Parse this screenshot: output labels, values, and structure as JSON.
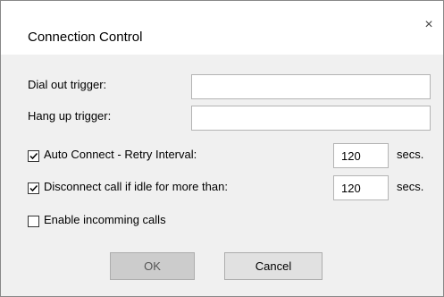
{
  "window": {
    "title": "Connection Control",
    "close_glyph": "×"
  },
  "fields": {
    "dial_out_label": "Dial out trigger:",
    "dial_out_value": "",
    "hang_up_label": "Hang up trigger:",
    "hang_up_value": ""
  },
  "options": {
    "auto_connect_label": "Auto Connect - Retry Interval:",
    "auto_connect_checked": true,
    "auto_connect_value": "120",
    "auto_connect_unit": "secs.",
    "disconnect_label": "Disconnect call if idle for more than:",
    "disconnect_checked": true,
    "disconnect_value": "120",
    "disconnect_unit": "secs.",
    "incoming_label": "Enable incomming calls",
    "incoming_checked": false
  },
  "buttons": {
    "ok_label": "OK",
    "cancel_label": "Cancel"
  }
}
